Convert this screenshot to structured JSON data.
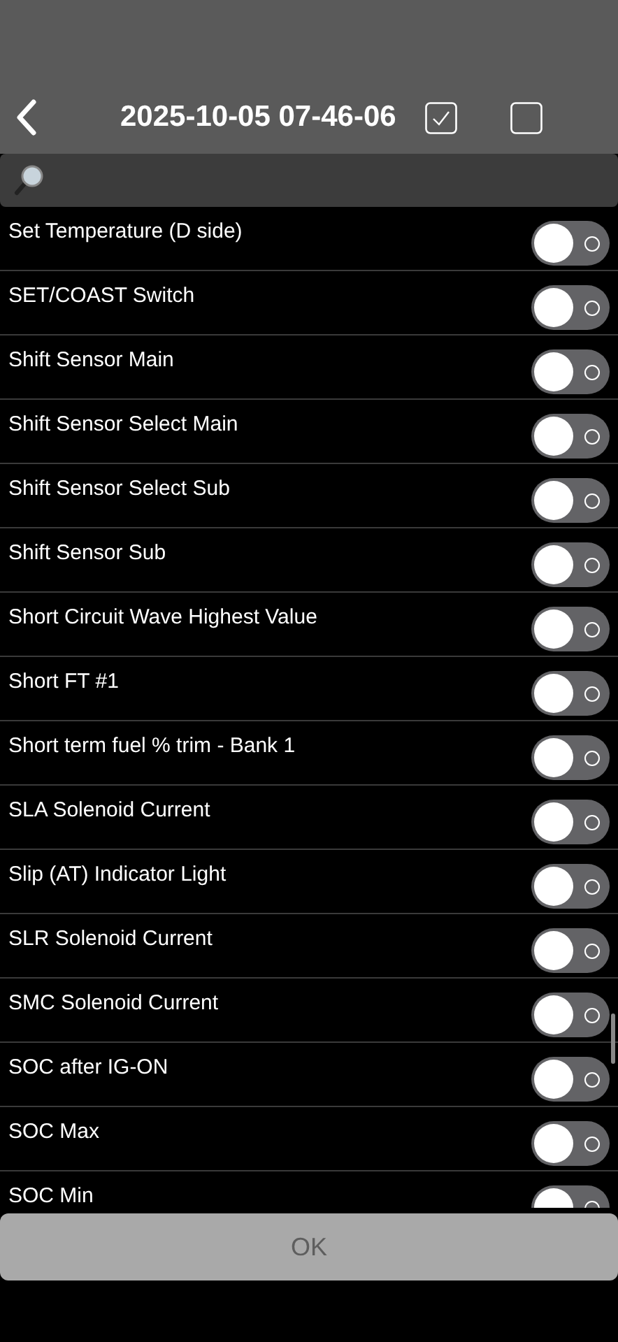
{
  "header": {
    "title": "2025-10-05 07-46-06"
  },
  "items": [
    {
      "label": "Set Temperature (D side)",
      "on": false
    },
    {
      "label": "SET/COAST Switch",
      "on": false
    },
    {
      "label": "Shift Sensor Main",
      "on": false
    },
    {
      "label": "Shift Sensor Select Main",
      "on": false
    },
    {
      "label": "Shift Sensor Select Sub",
      "on": false
    },
    {
      "label": "Shift Sensor Sub",
      "on": false
    },
    {
      "label": "Short Circuit Wave Highest Value",
      "on": false
    },
    {
      "label": "Short FT #1",
      "on": false
    },
    {
      "label": "Short term fuel % trim - Bank 1",
      "on": false
    },
    {
      "label": "SLA Solenoid Current",
      "on": false
    },
    {
      "label": "Slip (AT) Indicator Light",
      "on": false
    },
    {
      "label": "SLR Solenoid Current",
      "on": false
    },
    {
      "label": "SMC Solenoid Current",
      "on": false
    },
    {
      "label": "SOC after IG-ON",
      "on": false
    },
    {
      "label": "SOC Max",
      "on": false
    },
    {
      "label": "SOC Min",
      "on": false
    }
  ],
  "ok_button": {
    "label": "OK",
    "disabled": true
  }
}
